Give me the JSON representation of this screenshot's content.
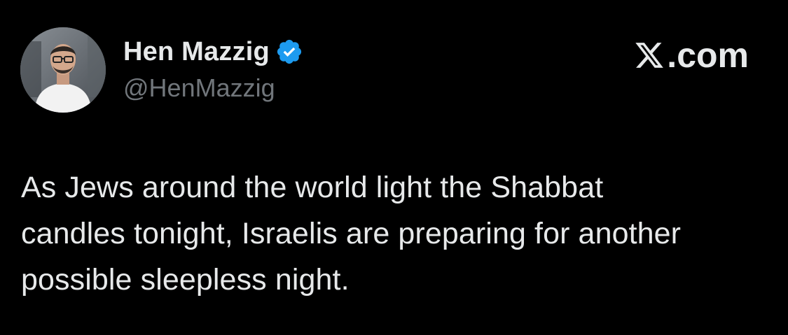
{
  "author": {
    "display_name": "Hen Mazzig",
    "handle": "@HenMazzig",
    "verified": true,
    "avatar_icon": "profile-photo",
    "verified_color": "#1d9bf0"
  },
  "brand": {
    "logo_icon": "x-logo-icon",
    "text": ".com"
  },
  "tweet": {
    "lines": [
      "As Jews around the world light the Shabbat",
      "candles tonight, Israelis are preparing for another",
      "possible sleepless night."
    ]
  },
  "colors": {
    "background": "#000000",
    "text_primary": "#e7e9ea",
    "text_secondary": "#71767b"
  }
}
